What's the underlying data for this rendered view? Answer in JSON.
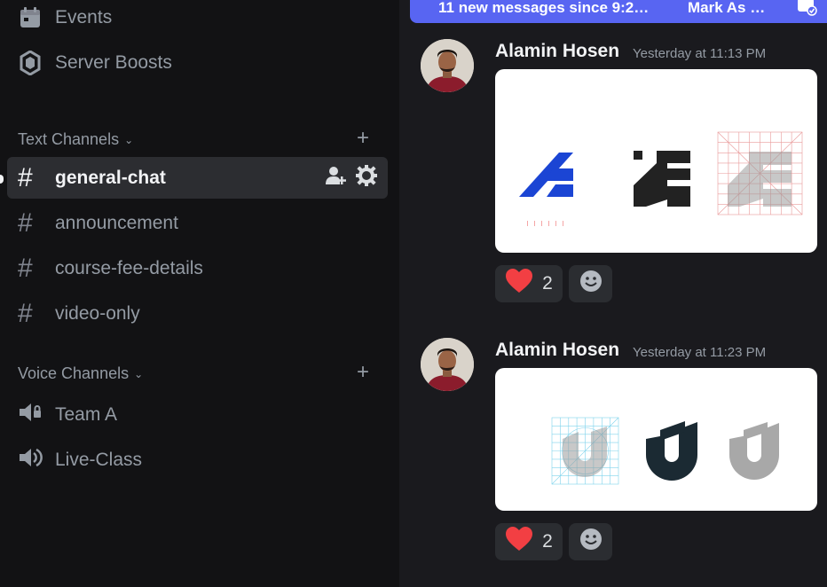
{
  "sidebar": {
    "top_items": [
      {
        "label": "Events",
        "icon": "calendar-icon"
      },
      {
        "label": "Server Boosts",
        "icon": "boost-gem-icon"
      }
    ],
    "text_category": "Text Channels",
    "text_channels": [
      {
        "name": "general-chat",
        "active": true
      },
      {
        "name": "announcement",
        "active": false
      },
      {
        "name": "course-fee-details",
        "active": false
      },
      {
        "name": "video-only",
        "active": false
      }
    ],
    "voice_category": "Voice Channels",
    "voice_channels": [
      {
        "name": "Team A"
      },
      {
        "name": "Live-Class"
      }
    ]
  },
  "banner": {
    "text": "11 new messages since 9:2…",
    "mark_label": "Mark As …",
    "color": "#5865f2"
  },
  "messages": [
    {
      "author": "Alamin Hosen",
      "timestamp": "Yesterday at 11:13 PM",
      "reaction": {
        "emoji": "heart",
        "count": "2"
      }
    },
    {
      "author": "Alamin Hosen",
      "timestamp": "Yesterday at 11:23 PM",
      "reaction": {
        "emoji": "heart",
        "count": "2"
      }
    }
  ],
  "colors": {
    "accent": "#5865f2",
    "heart": "#f23f43",
    "logo_blue": "#1b45d4",
    "logo_dark": "#1b2a33"
  }
}
